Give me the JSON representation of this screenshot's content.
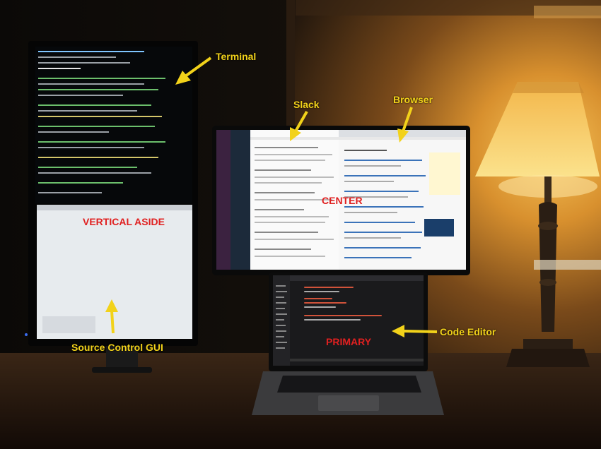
{
  "labels": {
    "terminal": "Terminal",
    "slack": "Slack",
    "browser": "Browser",
    "center": "CENTER",
    "vertical_aside": "VERTICAL ASIDE",
    "source_control": "Source Control GUI",
    "code_editor": "Code Editor",
    "primary": "PRIMARY"
  },
  "colors": {
    "label_yellow": "#f2d21a",
    "label_red": "#e02020",
    "wall_warm": "#c98a2a",
    "wall_dark": "#1a1410",
    "desk": "#2a1c12",
    "lamp_shade": "#f5c04a"
  },
  "icons": [
    "arrow-icon",
    "lamp-icon",
    "monitor-icon",
    "laptop-icon"
  ]
}
